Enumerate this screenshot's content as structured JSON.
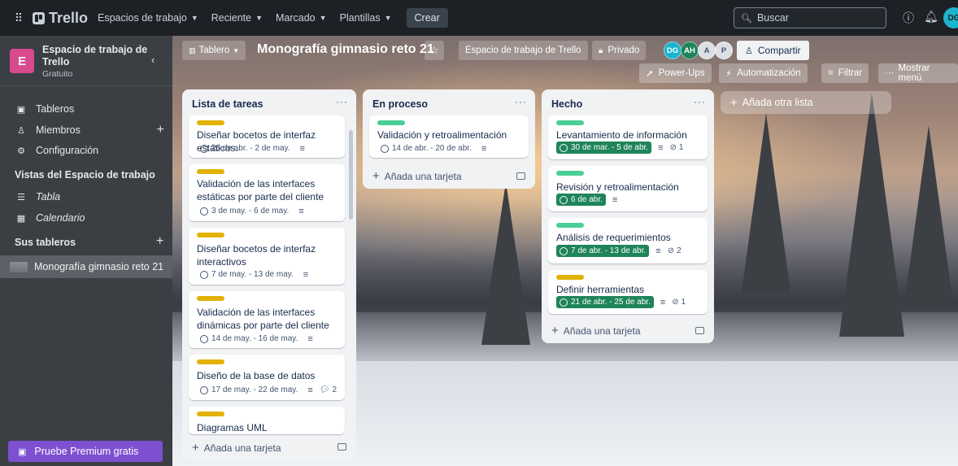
{
  "topnav": {
    "brand": "Trello",
    "menus": [
      "Espacios de trabajo",
      "Reciente",
      "Marcado",
      "Plantillas"
    ],
    "create": "Crear",
    "search_placeholder": "Buscar",
    "user_initials": "DG"
  },
  "sidebar": {
    "workspace_initial": "E",
    "workspace_name": "Espacio de trabajo de Trello",
    "workspace_plan": "Gratuito",
    "items": [
      {
        "label": "Tableros"
      },
      {
        "label": "Miembros"
      },
      {
        "label": "Configuración"
      }
    ],
    "views_title": "Vistas del Espacio de trabajo",
    "views": [
      {
        "label": "Tabla"
      },
      {
        "label": "Calendario"
      }
    ],
    "boards_title": "Sus tableros",
    "boards": [
      {
        "label": "Monografía gimnasio reto 21"
      }
    ],
    "premium": "Pruebe Premium gratis"
  },
  "board": {
    "view": "Tablero",
    "title": "Monografía gimnasio reto 21",
    "workspace_btn": "Espacio de trabajo de Trello",
    "visibility": "Privado",
    "members": [
      {
        "initials": "DG",
        "color": "#1bb3ce"
      },
      {
        "initials": "AH",
        "color": "#1f845a"
      },
      {
        "initials": "A",
        "color": "#dcdfe4"
      },
      {
        "initials": "P",
        "color": "#dcdfe4"
      }
    ],
    "share": "Compartir",
    "powerups": "Power-Ups",
    "automation": "Automatización",
    "filter": "Filtrar",
    "menu": "Mostrar menú",
    "add_list": "Añada otra lista",
    "add_card": "Añada una tarjeta"
  },
  "lists": [
    {
      "title": "Lista de tareas",
      "cards": [
        {
          "label_color": "#e2b203",
          "title": "Diseñar bocetos de interfaz estáticos.",
          "due": "26 de abr. - 2 de may."
        },
        {
          "label_color": "#e2b203",
          "title": "Validación de las interfaces estáticas por parte del cliente",
          "due": "3 de may. - 6 de may."
        },
        {
          "label_color": "#e2b203",
          "title": "Diseñar bocetos de interfaz interactivos",
          "due": "7 de may. - 13 de may."
        },
        {
          "label_color": "#e2b203",
          "title": "Validación de las interfaces dinámicas por parte del cliente",
          "due": "14 de may. - 16 de may."
        },
        {
          "label_color": "#e2b203",
          "title": "Diseño de la base de datos",
          "due": "17 de may. - 22 de may.",
          "comments": "2"
        },
        {
          "label_color": "#e2b203",
          "title": "Diagramas UML"
        }
      ]
    },
    {
      "title": "En proceso",
      "cards": [
        {
          "label_color": "#4bce97",
          "title": "Validación y retroalimentación",
          "due": "14 de abr. - 20 de abr."
        }
      ]
    },
    {
      "title": "Hecho",
      "cards": [
        {
          "label_color": "#4bce97",
          "title": "Levantamiento de información",
          "due": "30 de mar. - 5 de abr.",
          "attachments": "1"
        },
        {
          "label_color": "#4bce97",
          "title": "Revisión y retroalimentación",
          "due": "6 de abr."
        },
        {
          "label_color": "#4bce97",
          "title": "Análisis de requerimientos",
          "due": "7 de abr. - 13 de abr.",
          "attachments": "2"
        },
        {
          "label_color": "#e2b203",
          "title": "Definir herramientas",
          "due": "21 de abr. - 25 de abr.",
          "attachments": "1"
        }
      ]
    }
  ]
}
